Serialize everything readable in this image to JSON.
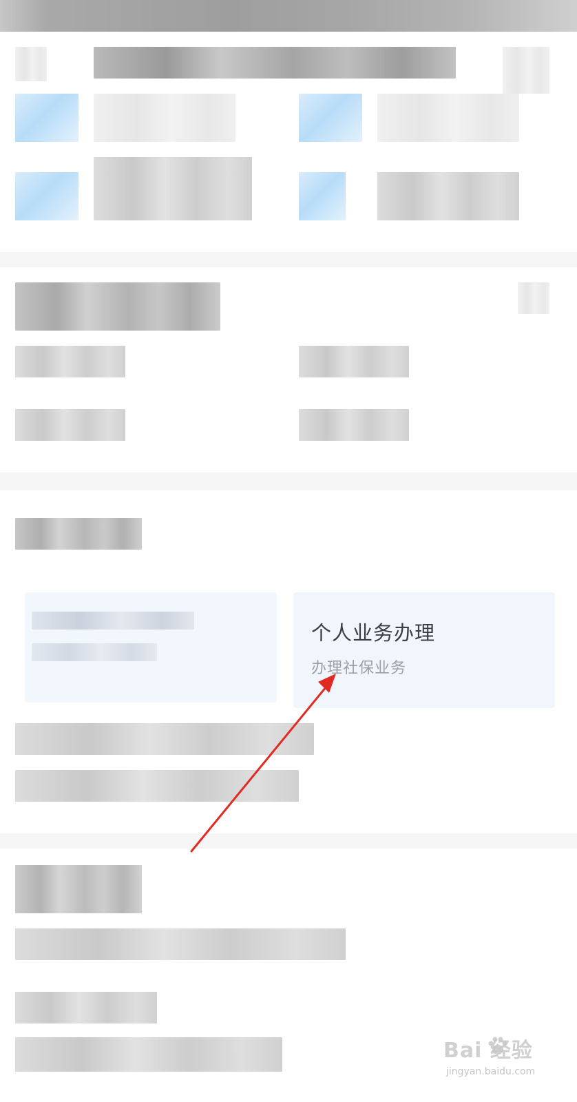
{
  "services_section": {
    "cards": [
      {
        "title": "",
        "subtitle": ""
      },
      {
        "title": "个人业务办理",
        "subtitle": "办理社保业务"
      }
    ]
  },
  "annotation": {
    "arrow_color": "#e02a22",
    "arrow_target": "personal-business-card"
  },
  "watermark": {
    "main": "Bai  经验",
    "sub": "jingyan.baidu.com"
  },
  "colors": {
    "card_background": "#f1f6fc",
    "card_title": "#3b3f45",
    "card_subtitle": "#9aa0a8",
    "icon_blue": "#b7dcf8"
  }
}
